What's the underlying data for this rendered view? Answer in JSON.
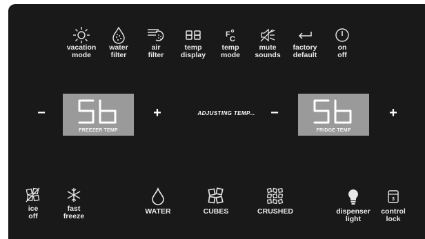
{
  "top_buttons": [
    {
      "icon": "sun-icon",
      "label": "vacation\nmode"
    },
    {
      "icon": "water-drop-icon",
      "label": "water\nfilter"
    },
    {
      "icon": "air-filter-icon",
      "label": "air\nfilter"
    },
    {
      "icon": "digits-88-icon",
      "label": "temp\ndisplay"
    },
    {
      "icon": "fahrenheit-celsius-icon",
      "label": "temp\nmode"
    },
    {
      "icon": "mute-speaker-icon",
      "label": "mute\nsounds"
    },
    {
      "icon": "return-arrow-icon",
      "label": "factory\ndefault"
    },
    {
      "icon": "power-icon",
      "label": "on\noff"
    }
  ],
  "freezer": {
    "display_value": "5b",
    "label": "FREEZER TEMP",
    "minus": "−",
    "plus": "+"
  },
  "fridge": {
    "display_value": "5b",
    "label": "FRIDGE TEMP",
    "minus": "−",
    "plus": "+"
  },
  "status_text": "ADJUSTING TEMP...",
  "bottom_buttons": [
    {
      "icon": "ice-off-icon",
      "label": "ice\noff"
    },
    {
      "icon": "snowflake-icon",
      "label": "fast\nfreeze"
    },
    {
      "icon": "water-drop-outline-icon",
      "label": "WATER"
    },
    {
      "icon": "ice-cubes-icon",
      "label": "CUBES"
    },
    {
      "icon": "crushed-ice-icon",
      "label": "CRUSHED"
    },
    {
      "icon": "light-bulb-icon",
      "label": "dispenser\nlight"
    },
    {
      "icon": "lock-icon",
      "label": "control\nlock",
      "badge": "3"
    }
  ],
  "colors": {
    "panel": "#191919",
    "display": "#9a9a9a",
    "text": "#eaeaea"
  }
}
